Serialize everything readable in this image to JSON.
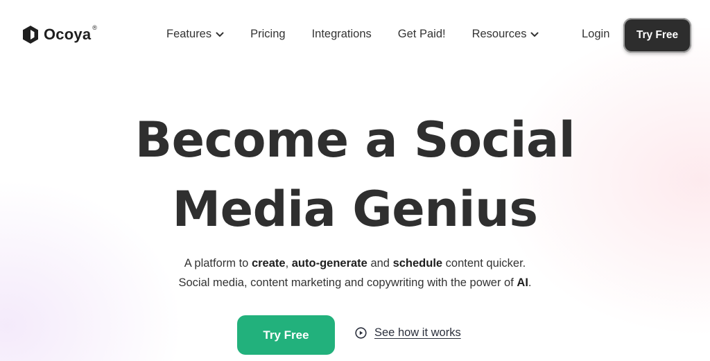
{
  "brand": {
    "name": "Ocoya",
    "registered": "®"
  },
  "nav": {
    "items": [
      {
        "label": "Features",
        "has_dropdown": true
      },
      {
        "label": "Pricing",
        "has_dropdown": false
      },
      {
        "label": "Integrations",
        "has_dropdown": false
      },
      {
        "label": "Get Paid!",
        "has_dropdown": false
      },
      {
        "label": "Resources",
        "has_dropdown": true
      }
    ],
    "login_label": "Login",
    "cta_label": "Try Free"
  },
  "hero": {
    "title_line1": "Become a Social",
    "title_line2": "Media Genius",
    "subtitle_line1": {
      "part1": "A platform to ",
      "bold1": "create",
      "part2": ", ",
      "bold2": "auto-generate",
      "part3": " and ",
      "bold3": "schedule",
      "part4": " content quicker."
    },
    "subtitle_line2": {
      "part1": "Social media, content marketing and copywriting with the power of ",
      "bold1": "AI",
      "part2": "."
    },
    "primary_cta_label": "Try Free",
    "secondary_cta_label": "See how it works"
  },
  "colors": {
    "primary_cta": "#22b17c",
    "nav_cta": "#2d2d2d",
    "heading": "#2f2f2f"
  },
  "icons": {
    "logo": "ocoya-cube-logo-icon",
    "dropdown": "chevron-down-icon",
    "play": "play-circle-icon"
  }
}
